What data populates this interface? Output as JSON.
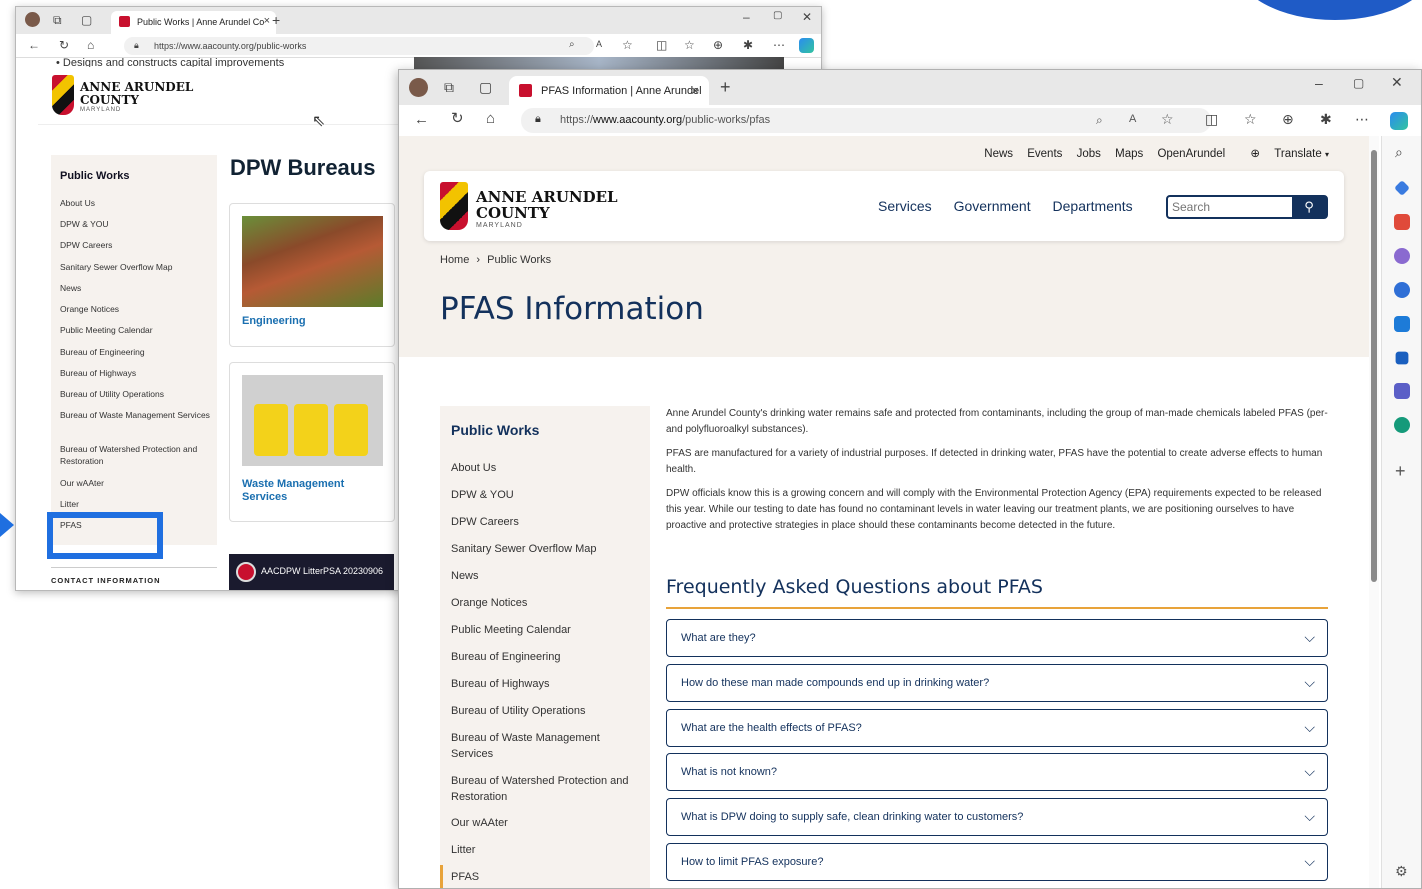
{
  "back_window": {
    "tab_title": "Public Works | Anne Arundel Co",
    "url": "https://www.aacounty.org/public-works",
    "designs_text": "• Designs and constructs capital improvements",
    "logo": {
      "name": "ANNE ARUNDEL",
      "county": "COUNTY",
      "state": "MARYLAND"
    },
    "sidebar_title": "Public Works",
    "sidebar_items": [
      "About Us",
      "DPW & YOU",
      "DPW Careers",
      "Sanitary Sewer Overflow Map",
      "News",
      "Orange Notices",
      "Public Meeting Calendar",
      "Bureau of Engineering",
      "Bureau of Highways",
      "Bureau of Utility Operations",
      "Bureau of Waste Management Services",
      "Bureau of Watershed Protection and Restoration",
      "Our wAAter",
      "Litter",
      "PFAS"
    ],
    "bureaus_title": "DPW Bureaus",
    "cards": [
      {
        "label": "Engineering"
      },
      {
        "label": "Waste Management Services"
      }
    ],
    "contact": "CONTACT INFORMATION",
    "video_title": "AACDPW LitterPSA 20230906"
  },
  "front_window": {
    "tab_title": "PFAS Information | Anne Arundel",
    "url_prefix": "https://",
    "url_domain": "www.aacounty.org",
    "url_path": "/public-works/pfas",
    "utility_nav": [
      "News",
      "Events",
      "Jobs",
      "Maps",
      "OpenArundel",
      "Translate"
    ],
    "logo": {
      "name": "ANNE ARUNDEL",
      "county": "COUNTY",
      "state": "MARYLAND"
    },
    "main_nav": [
      "Services",
      "Government",
      "Departments"
    ],
    "search_placeholder": "Search",
    "breadcrumb": [
      "Home",
      "Public Works"
    ],
    "page_title": "PFAS Information",
    "sidebar_title": "Public Works",
    "sidebar_items": [
      "About Us",
      "DPW & YOU",
      "DPW Careers",
      "Sanitary Sewer Overflow Map",
      "News",
      "Orange Notices",
      "Public Meeting Calendar",
      "Bureau of Engineering",
      "Bureau of Highways",
      "Bureau of Utility Operations",
      "Bureau of Waste Management Services",
      "Bureau of Watershed Protection and Restoration",
      "Our wAAter",
      "Litter",
      "PFAS"
    ],
    "paragraphs": [
      "Anne Arundel County's drinking water remains safe and protected from contaminants, including the group of man-made chemicals labeled PFAS (per- and polyfluoroalkyl substances).",
      "PFAS are manufactured for a variety of industrial purposes. If detected in drinking water, PFAS have the potential to create adverse effects to human health.",
      "DPW officials know this is a growing concern and will comply with the Environmental Protection Agency (EPA) requirements expected to be released this year. While our testing to date has found no contaminant levels in water leaving our treatment plants, we are positioning ourselves to have proactive and protective strategies in place should these contaminants become detected in the future."
    ],
    "faq_title": "Frequently Asked Questions about PFAS",
    "faqs": [
      "What are they?",
      "How do these man made compounds end up in drinking water?",
      "What are the health effects of PFAS?",
      "What is not known?",
      "What is DPW doing to supply safe, clean drinking water to customers?",
      "How to limit PFAS exposure?"
    ]
  },
  "colors": {
    "navy": "#13315c",
    "accent_orange": "#e8a33a",
    "highlight_blue": "#1f6fe0",
    "hero_bg": "#f5f1ec"
  },
  "icons": [
    "back-arrow-icon",
    "refresh-icon",
    "home-icon",
    "lock-icon",
    "zoom-icon",
    "read-aloud-icon",
    "favorite-star-icon",
    "split-screen-icon",
    "favorites-icon",
    "collections-icon",
    "extensions-icon",
    "more-icon",
    "copilot-icon",
    "search-icon",
    "globe-icon",
    "chevron-down-icon",
    "settings-gear-icon"
  ]
}
